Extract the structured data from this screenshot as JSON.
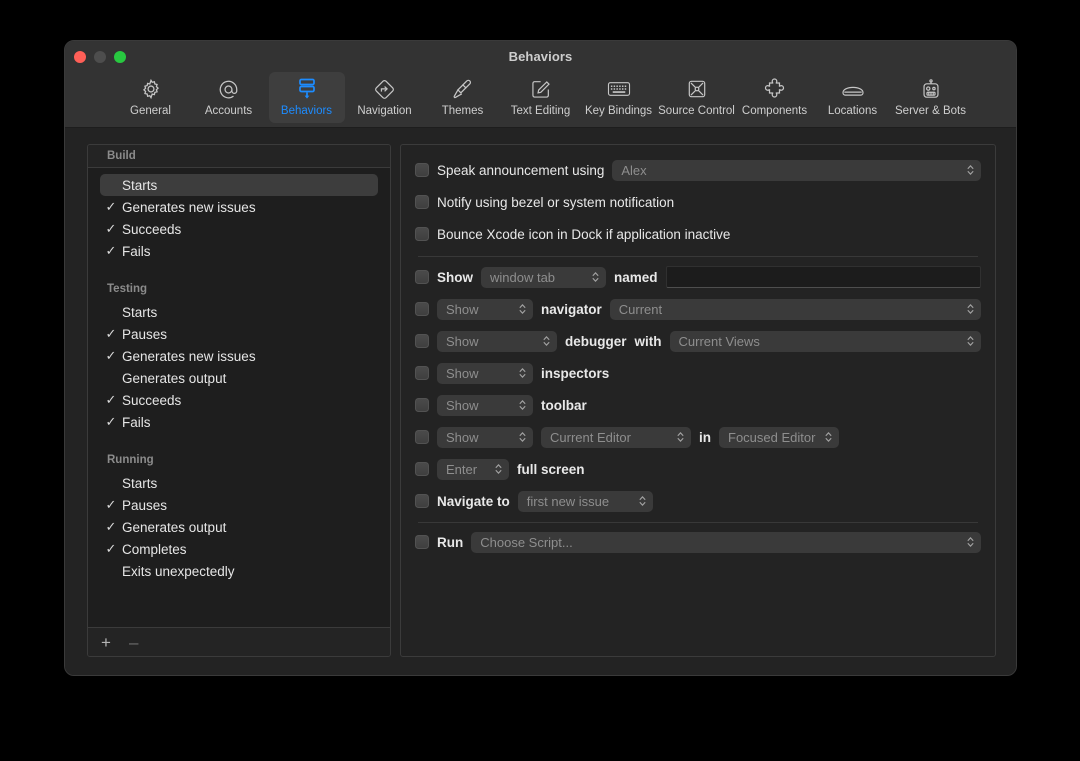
{
  "window": {
    "title": "Behaviors",
    "traffic_lights": [
      "close-button",
      "minimize-button",
      "zoom-button"
    ]
  },
  "toolbar": {
    "items": [
      {
        "label": "General",
        "icon": "gear-icon",
        "selected": false
      },
      {
        "label": "Accounts",
        "icon": "at-sign-icon",
        "selected": false
      },
      {
        "label": "Behaviors",
        "icon": "behaviors-icon",
        "selected": true
      },
      {
        "label": "Navigation",
        "icon": "navigation-icon",
        "selected": false
      },
      {
        "label": "Themes",
        "icon": "paintbrush-icon",
        "selected": false
      },
      {
        "label": "Text Editing",
        "icon": "pencil-square-icon",
        "selected": false
      },
      {
        "label": "Key Bindings",
        "icon": "keyboard-icon",
        "selected": false
      },
      {
        "label": "Source Control",
        "icon": "source-control-icon",
        "selected": false
      },
      {
        "label": "Components",
        "icon": "puzzle-piece-icon",
        "selected": false
      },
      {
        "label": "Locations",
        "icon": "drive-icon",
        "selected": false
      },
      {
        "label": "Server & Bots",
        "icon": "robot-icon",
        "selected": false
      }
    ],
    "accent_color": "#1d8cff"
  },
  "sidebar": {
    "header": "Build",
    "add_button": "+",
    "remove_button": "–",
    "groups": [
      {
        "title": null,
        "items": [
          {
            "label": "Starts",
            "checked": false,
            "selected": true
          },
          {
            "label": "Generates new issues",
            "checked": true,
            "selected": false
          },
          {
            "label": "Succeeds",
            "checked": true,
            "selected": false
          },
          {
            "label": "Fails",
            "checked": true,
            "selected": false
          }
        ]
      },
      {
        "title": "Testing",
        "items": [
          {
            "label": "Starts",
            "checked": false,
            "selected": false
          },
          {
            "label": "Pauses",
            "checked": true,
            "selected": false
          },
          {
            "label": "Generates new issues",
            "checked": true,
            "selected": false
          },
          {
            "label": "Generates output",
            "checked": false,
            "selected": false
          },
          {
            "label": "Succeeds",
            "checked": true,
            "selected": false
          },
          {
            "label": "Fails",
            "checked": true,
            "selected": false
          }
        ]
      },
      {
        "title": "Running",
        "items": [
          {
            "label": "Starts",
            "checked": false,
            "selected": false
          },
          {
            "label": "Pauses",
            "checked": true,
            "selected": false
          },
          {
            "label": "Generates output",
            "checked": true,
            "selected": false
          },
          {
            "label": "Completes",
            "checked": true,
            "selected": false
          },
          {
            "label": "Exits unexpectedly",
            "checked": false,
            "selected": false
          }
        ]
      }
    ],
    "check_glyph": "✓"
  },
  "pane": {
    "speak": {
      "label": "Speak announcement using",
      "voice": "Alex"
    },
    "notify_label": "Notify using bezel or system notification",
    "bounce_label": "Bounce Xcode icon in Dock if application inactive",
    "window_tab": {
      "show_label": "Show",
      "target": "window tab",
      "named_label": "named",
      "name_value": "",
      "name_placeholder": ""
    },
    "navigator": {
      "action": "Show",
      "label": "navigator",
      "which": "Current"
    },
    "debugger": {
      "action": "Show",
      "label": "debugger",
      "with_label": "with",
      "which": "Current Views"
    },
    "inspectors": {
      "action": "Show",
      "label": "inspectors"
    },
    "toolbar_row": {
      "action": "Show",
      "label": "toolbar"
    },
    "editor": {
      "action": "Show",
      "target": "Current Editor",
      "in_label": "in",
      "destination": "Focused Editor"
    },
    "full_screen": {
      "action": "Enter",
      "label": "full screen"
    },
    "navigate": {
      "label": "Navigate to",
      "target": "first new issue"
    },
    "run": {
      "label": "Run",
      "script": "Choose Script..."
    }
  }
}
